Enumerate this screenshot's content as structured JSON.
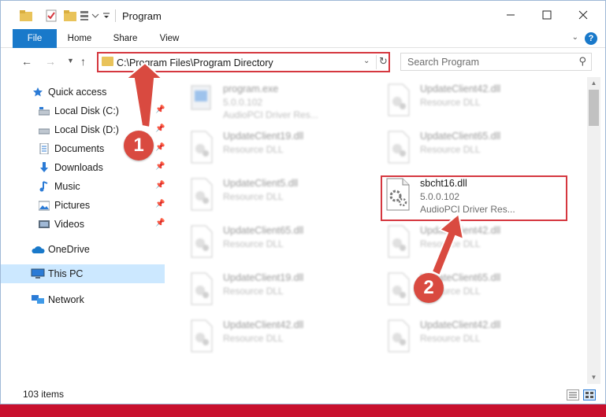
{
  "window": {
    "title": "Program"
  },
  "ribbon": {
    "tabs": [
      "File",
      "Home",
      "Share",
      "View"
    ]
  },
  "address_bar": {
    "path": "C:\\Program Files\\Program Directory"
  },
  "search": {
    "placeholder": "Search Program"
  },
  "sidebar": {
    "items": [
      {
        "label": "Quick access",
        "icon": "star-icon"
      },
      {
        "label": "Local Disk (C:)",
        "icon": "drive-icon",
        "pinned": true
      },
      {
        "label": "Local Disk (D:)",
        "icon": "drive-icon",
        "pinned": true
      },
      {
        "label": "Documents",
        "icon": "documents-icon",
        "pinned": true
      },
      {
        "label": "Downloads",
        "icon": "download-icon",
        "pinned": true
      },
      {
        "label": "Music",
        "icon": "music-icon",
        "pinned": true
      },
      {
        "label": "Pictures",
        "icon": "pictures-icon",
        "pinned": true
      },
      {
        "label": "Videos",
        "icon": "videos-icon",
        "pinned": true
      },
      {
        "label": "OneDrive",
        "icon": "cloud-icon"
      },
      {
        "label": "This PC",
        "icon": "computer-icon",
        "selected": true
      },
      {
        "label": "Network",
        "icon": "network-icon"
      }
    ]
  },
  "files": [
    {
      "name": "program.exe",
      "line2": "5.0.0.102",
      "line3": "AudioPCI Driver Res..."
    },
    {
      "name": "UpdateClient42.dll",
      "line2": "Resource DLL",
      "line3": ""
    },
    {
      "name": "UpdateClient19.dll",
      "line2": "Resource DLL",
      "line3": ""
    },
    {
      "name": "UpdateClient65.dll",
      "line2": "Resource DLL",
      "line3": ""
    },
    {
      "name": "UpdateClient5.dll",
      "line2": "Resource DLL",
      "line3": ""
    },
    {
      "name": "sbcht16.dll",
      "line2": "5.0.0.102",
      "line3": "AudioPCI Driver Res..."
    },
    {
      "name": "UpdateClient65.dll",
      "line2": "Resource DLL",
      "line3": ""
    },
    {
      "name": "UpdateClient42.dll",
      "line2": "Resource DLL",
      "line3": ""
    },
    {
      "name": "UpdateClient19.dll",
      "line2": "Resource DLL",
      "line3": ""
    },
    {
      "name": "UpdateClient65.dll",
      "line2": "Resource DLL",
      "line3": ""
    },
    {
      "name": "UpdateClient42.dll",
      "line2": "Resource DLL",
      "line3": ""
    },
    {
      "name": "UpdateClient42.dll",
      "line2": "Resource DLL",
      "line3": ""
    }
  ],
  "status": {
    "item_count": "103 items"
  },
  "annotations": {
    "step1": "1",
    "step2": "2"
  },
  "colors": {
    "accent": "#1979ca",
    "highlight": "#d5373f",
    "callout": "#d94a40",
    "selection": "#cce8ff"
  }
}
